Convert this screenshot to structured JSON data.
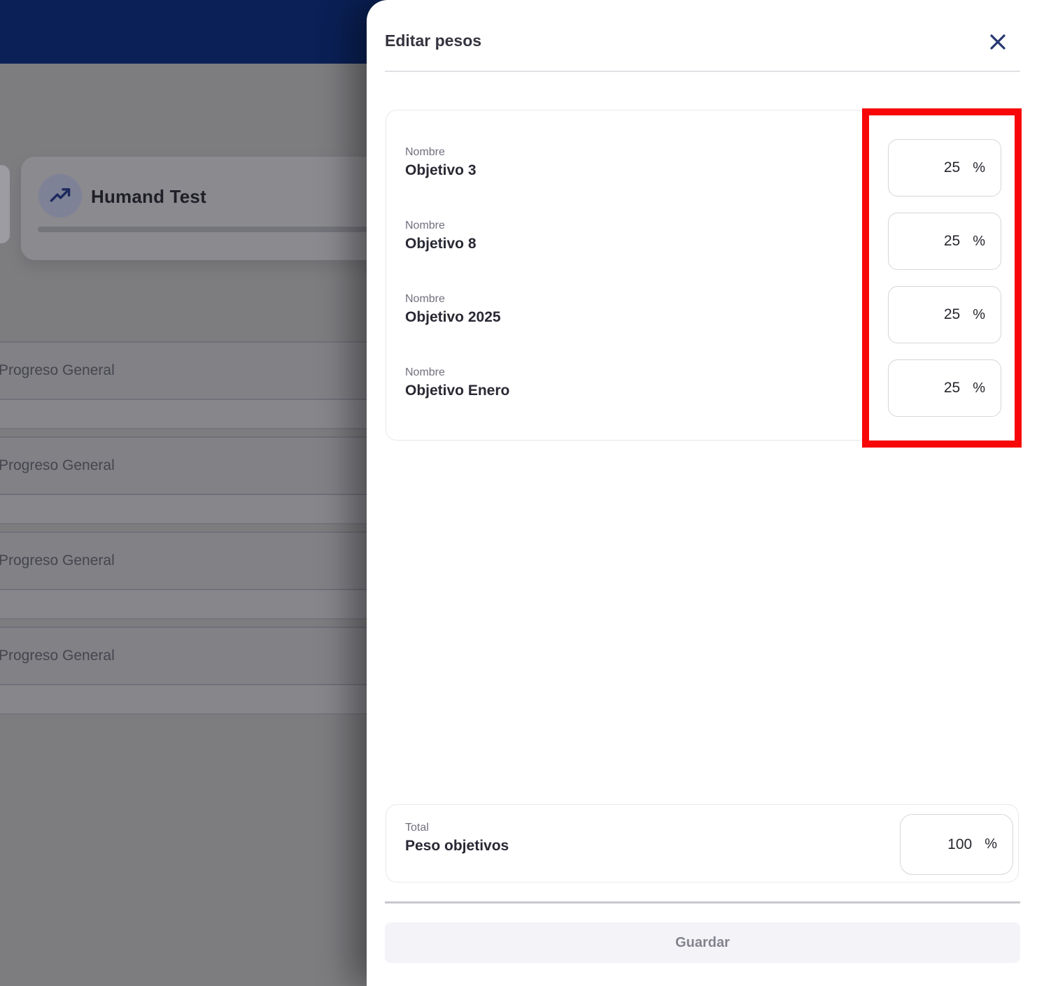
{
  "background": {
    "card_title": "Humand Test",
    "rows": [
      {
        "label": "Progreso General"
      },
      {
        "label": "Progreso General"
      },
      {
        "label": "Progreso General"
      },
      {
        "label": "Progreso General"
      }
    ]
  },
  "drawer": {
    "title": "Editar pesos",
    "objectives": [
      {
        "field_label": "Nombre",
        "name": "Objetivo 3",
        "weight": "25",
        "unit": "%"
      },
      {
        "field_label": "Nombre",
        "name": "Objetivo 8",
        "weight": "25",
        "unit": "%"
      },
      {
        "field_label": "Nombre",
        "name": "Objetivo 2025",
        "weight": "25",
        "unit": "%"
      },
      {
        "field_label": "Nombre",
        "name": "Objetivo Enero",
        "weight": "25",
        "unit": "%"
      }
    ],
    "total": {
      "field_label": "Total",
      "name": "Peso objetivos",
      "value": "100",
      "unit": "%"
    },
    "save_label": "Guardar"
  },
  "icons": {
    "close": "close-icon",
    "trending_up": "trending-up-icon"
  },
  "colors": {
    "nav_bar": "#0a2056",
    "annotation_red": "#f70707",
    "accent_navy": "#27376f"
  }
}
